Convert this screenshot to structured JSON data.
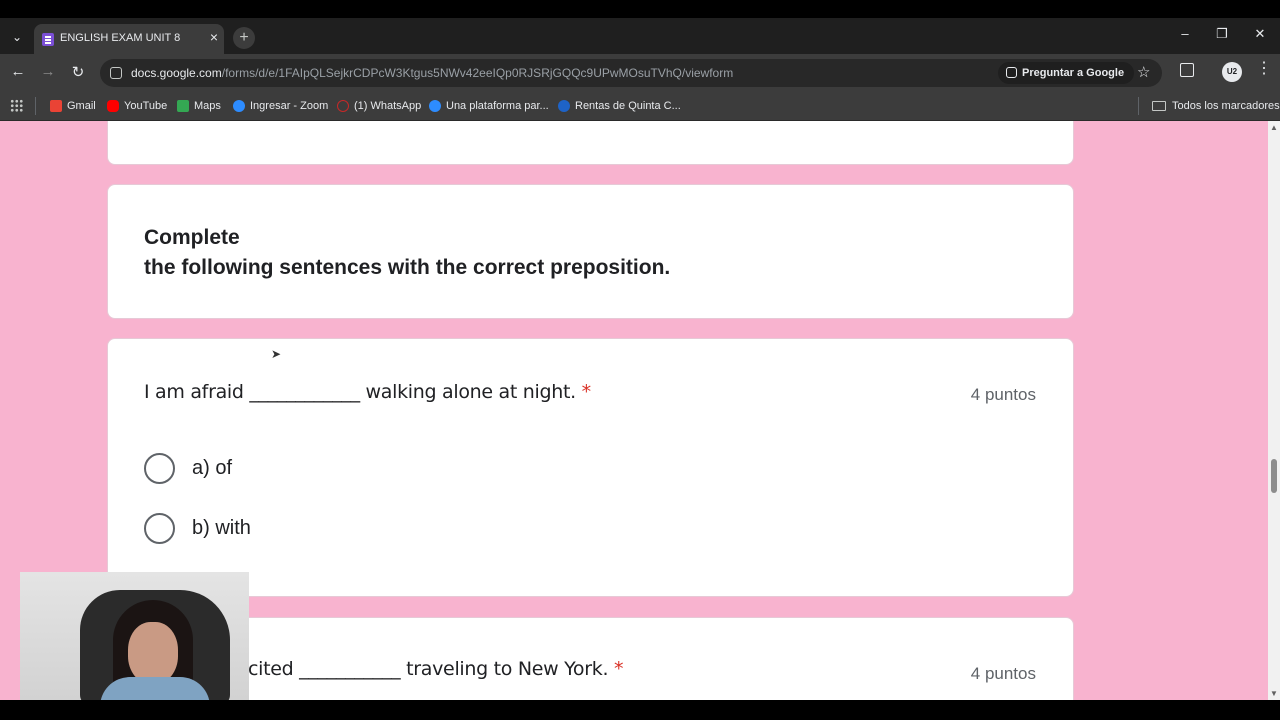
{
  "browser": {
    "tab_title": "ENGLISH EXAM UNIT 8",
    "url_host": "docs.google.com",
    "url_path": "/forms/d/e/1FAIpQLSejkrCDPcW3Ktgus5NWv42eeIQp0RJSRjGQQc9UPwMOsuTVhQ/viewform",
    "ask_google_label": "Preguntar a Google",
    "profile_initials": "U2",
    "bookmarks": [
      {
        "label": "Gmail",
        "color": "#ea4335"
      },
      {
        "label": "YouTube",
        "color": "#ff0000"
      },
      {
        "label": "Maps",
        "color": "#34a853"
      },
      {
        "label": "Ingresar - Zoom",
        "color": "#2d8cff"
      },
      {
        "label": "(1) WhatsApp",
        "color": "#c62828"
      },
      {
        "label": "Una plataforma par...",
        "color": "#2d8cff"
      },
      {
        "label": "Rentas de Quinta C...",
        "color": "#1e63c7"
      }
    ],
    "all_bookmarks_label": "Todos los marcadores"
  },
  "form": {
    "section_title_line1": "Complete",
    "section_title_line2": "the following sentences with the correct preposition.",
    "q1": {
      "text": "I am afraid ____________ walking alone at night.",
      "required_mark": "*",
      "points": "4 puntos",
      "options": [
        "a) of",
        "b) with"
      ]
    },
    "q2": {
      "text": "cited ___________ traveling to New York.",
      "required_mark": "*",
      "points": "4 puntos"
    }
  },
  "colors": {
    "page_background": "#f8b3cf",
    "required": "#d93025"
  }
}
